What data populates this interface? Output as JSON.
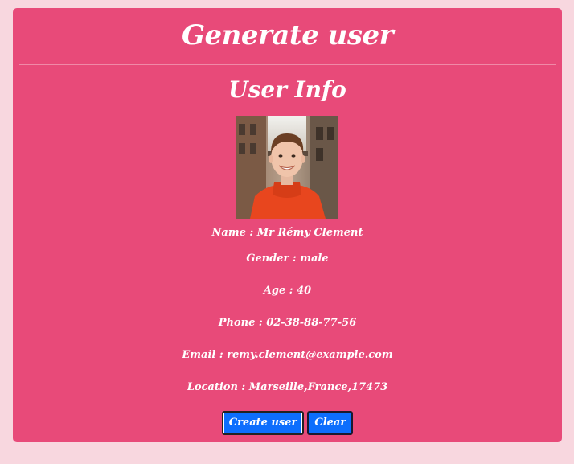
{
  "header": {
    "title": "Generate user"
  },
  "user_info": {
    "heading": "User Info",
    "name": "Name : Mr Rémy Clement",
    "gender": "Gender : male",
    "age": "Age : 40",
    "phone": "Phone : 02-38-88-77-56",
    "email": "Email : remy.clement@example.com",
    "location": "Location : Marseille,France,17473"
  },
  "actions": {
    "create_label": "Create user",
    "clear_label": "Clear"
  },
  "colors": {
    "page_bg": "#f8d7df",
    "card_bg": "#e84a79",
    "button_bg": "#0d6efd",
    "text": "#ffffff"
  }
}
